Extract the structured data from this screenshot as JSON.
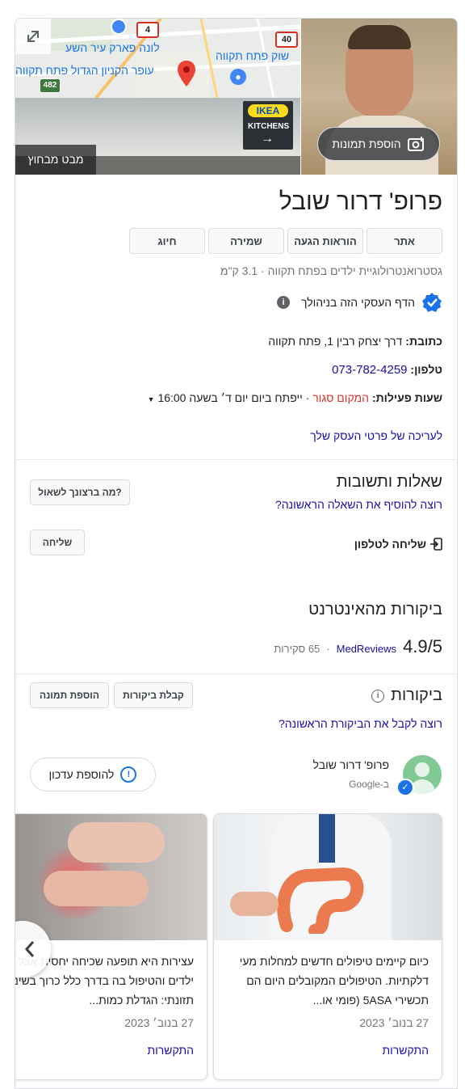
{
  "map": {
    "road_4": "4",
    "road_40": "40",
    "road_482": "482",
    "label_luna": "לונה פארק עיר השע",
    "label_shuk": "שוק פתח תקווה",
    "label_ofer": "עופר הקניון הגדול פתח תקווה"
  },
  "street_view": {
    "label": "מבט מבחוץ",
    "ikea": "IKEA",
    "kitchens": "KITCHENS"
  },
  "photo": {
    "add_photos": "הוספת תמונות"
  },
  "business": {
    "title": "פרופ' דרור שובל",
    "category": "גסטרואנטרולוגיית ילדים בפתח תקווה",
    "distance": "3.1 ק\"מ",
    "verified_text": "הדף העסקי הזה בניהולך"
  },
  "actions": {
    "website": "אתר",
    "directions": "הוראות הגעה",
    "save": "שמירה",
    "call": "חיוג"
  },
  "details": {
    "address_label": "כתובת:",
    "address_value": "דרך יצחק רבין 1, פתח תקווה",
    "phone_label": "טלפון:",
    "phone_value": "073-782-4259",
    "hours_label": "שעות פעילות:",
    "hours_closed": "המקום סגור",
    "hours_sep": "·",
    "hours_open": "ייפתח ביום יום ד׳ בשעה 16:00",
    "edit_link": "לעריכה של פרטי העסק שלך"
  },
  "qa": {
    "title": "שאלות ותשובות",
    "add_first": "רוצה להוסיף את השאלה הראשונה?",
    "ask_button": "מה ברצונך לשאול?",
    "send_to_phone": "שליחה לטלפון",
    "send_button": "שליחה"
  },
  "web_reviews": {
    "title": "ביקורות מהאינטרנט",
    "score": "4.9/5",
    "source": "MedReviews",
    "sep": "·",
    "count": "65 סקירות"
  },
  "reviews": {
    "title": "ביקורות",
    "get_reviews": "קבלת ביקורות",
    "add_photo": "הוספת תמונה",
    "first_review": "רוצה לקבל את הביקורת הראשונה?"
  },
  "post": {
    "author": "פרופ' דרור שובל",
    "source": "ב-Google",
    "update_button": "להוספת עדכון"
  },
  "updates": [
    {
      "text": "כיום קיימים טיפולים חדשים למחלות מעי דלקתיות. הטיפולים המקובלים היום הם תכשירי 5ASA (פומי או...",
      "date": "27 בנוב׳ 2023",
      "cta": "התקשרות"
    },
    {
      "text": "עצירות היא תופעה שכיחה יחסית אצל ילדים והטיפול בה בדרך כלל כרוך בשינוי תזונתי: הגדלת כמות...",
      "date": "27 בנוב׳ 2023",
      "cta": "התקשרות"
    }
  ],
  "colors": {
    "link": "#1a0dab",
    "closed": "#d93025",
    "verified": "#1a73e8",
    "map_pin": "#ea4335"
  }
}
